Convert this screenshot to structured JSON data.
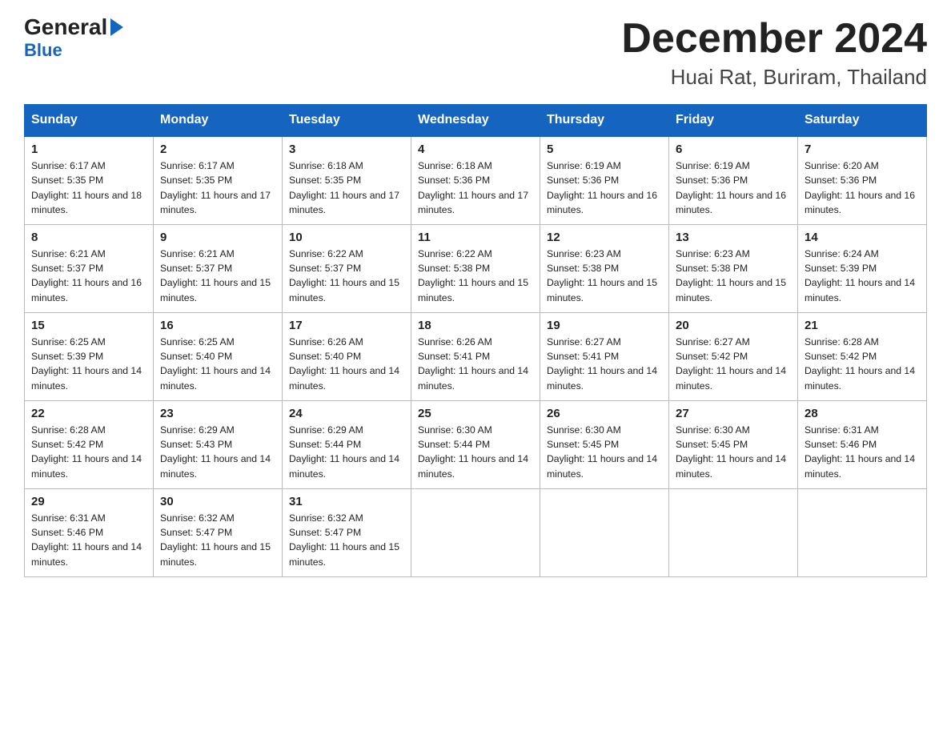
{
  "header": {
    "logo_general": "General",
    "logo_blue": "Blue",
    "title": "December 2024",
    "subtitle": "Huai Rat, Buriram, Thailand"
  },
  "days_of_week": [
    "Sunday",
    "Monday",
    "Tuesday",
    "Wednesday",
    "Thursday",
    "Friday",
    "Saturday"
  ],
  "weeks": [
    [
      {
        "day": "1",
        "sunrise": "6:17 AM",
        "sunset": "5:35 PM",
        "daylight": "11 hours and 18 minutes."
      },
      {
        "day": "2",
        "sunrise": "6:17 AM",
        "sunset": "5:35 PM",
        "daylight": "11 hours and 17 minutes."
      },
      {
        "day": "3",
        "sunrise": "6:18 AM",
        "sunset": "5:35 PM",
        "daylight": "11 hours and 17 minutes."
      },
      {
        "day": "4",
        "sunrise": "6:18 AM",
        "sunset": "5:36 PM",
        "daylight": "11 hours and 17 minutes."
      },
      {
        "day": "5",
        "sunrise": "6:19 AM",
        "sunset": "5:36 PM",
        "daylight": "11 hours and 16 minutes."
      },
      {
        "day": "6",
        "sunrise": "6:19 AM",
        "sunset": "5:36 PM",
        "daylight": "11 hours and 16 minutes."
      },
      {
        "day": "7",
        "sunrise": "6:20 AM",
        "sunset": "5:36 PM",
        "daylight": "11 hours and 16 minutes."
      }
    ],
    [
      {
        "day": "8",
        "sunrise": "6:21 AM",
        "sunset": "5:37 PM",
        "daylight": "11 hours and 16 minutes."
      },
      {
        "day": "9",
        "sunrise": "6:21 AM",
        "sunset": "5:37 PM",
        "daylight": "11 hours and 15 minutes."
      },
      {
        "day": "10",
        "sunrise": "6:22 AM",
        "sunset": "5:37 PM",
        "daylight": "11 hours and 15 minutes."
      },
      {
        "day": "11",
        "sunrise": "6:22 AM",
        "sunset": "5:38 PM",
        "daylight": "11 hours and 15 minutes."
      },
      {
        "day": "12",
        "sunrise": "6:23 AM",
        "sunset": "5:38 PM",
        "daylight": "11 hours and 15 minutes."
      },
      {
        "day": "13",
        "sunrise": "6:23 AM",
        "sunset": "5:38 PM",
        "daylight": "11 hours and 15 minutes."
      },
      {
        "day": "14",
        "sunrise": "6:24 AM",
        "sunset": "5:39 PM",
        "daylight": "11 hours and 14 minutes."
      }
    ],
    [
      {
        "day": "15",
        "sunrise": "6:25 AM",
        "sunset": "5:39 PM",
        "daylight": "11 hours and 14 minutes."
      },
      {
        "day": "16",
        "sunrise": "6:25 AM",
        "sunset": "5:40 PM",
        "daylight": "11 hours and 14 minutes."
      },
      {
        "day": "17",
        "sunrise": "6:26 AM",
        "sunset": "5:40 PM",
        "daylight": "11 hours and 14 minutes."
      },
      {
        "day": "18",
        "sunrise": "6:26 AM",
        "sunset": "5:41 PM",
        "daylight": "11 hours and 14 minutes."
      },
      {
        "day": "19",
        "sunrise": "6:27 AM",
        "sunset": "5:41 PM",
        "daylight": "11 hours and 14 minutes."
      },
      {
        "day": "20",
        "sunrise": "6:27 AM",
        "sunset": "5:42 PM",
        "daylight": "11 hours and 14 minutes."
      },
      {
        "day": "21",
        "sunrise": "6:28 AM",
        "sunset": "5:42 PM",
        "daylight": "11 hours and 14 minutes."
      }
    ],
    [
      {
        "day": "22",
        "sunrise": "6:28 AM",
        "sunset": "5:42 PM",
        "daylight": "11 hours and 14 minutes."
      },
      {
        "day": "23",
        "sunrise": "6:29 AM",
        "sunset": "5:43 PM",
        "daylight": "11 hours and 14 minutes."
      },
      {
        "day": "24",
        "sunrise": "6:29 AM",
        "sunset": "5:44 PM",
        "daylight": "11 hours and 14 minutes."
      },
      {
        "day": "25",
        "sunrise": "6:30 AM",
        "sunset": "5:44 PM",
        "daylight": "11 hours and 14 minutes."
      },
      {
        "day": "26",
        "sunrise": "6:30 AM",
        "sunset": "5:45 PM",
        "daylight": "11 hours and 14 minutes."
      },
      {
        "day": "27",
        "sunrise": "6:30 AM",
        "sunset": "5:45 PM",
        "daylight": "11 hours and 14 minutes."
      },
      {
        "day": "28",
        "sunrise": "6:31 AM",
        "sunset": "5:46 PM",
        "daylight": "11 hours and 14 minutes."
      }
    ],
    [
      {
        "day": "29",
        "sunrise": "6:31 AM",
        "sunset": "5:46 PM",
        "daylight": "11 hours and 14 minutes."
      },
      {
        "day": "30",
        "sunrise": "6:32 AM",
        "sunset": "5:47 PM",
        "daylight": "11 hours and 15 minutes."
      },
      {
        "day": "31",
        "sunrise": "6:32 AM",
        "sunset": "5:47 PM",
        "daylight": "11 hours and 15 minutes."
      },
      null,
      null,
      null,
      null
    ]
  ],
  "labels": {
    "sunrise": "Sunrise:",
    "sunset": "Sunset:",
    "daylight": "Daylight:"
  }
}
